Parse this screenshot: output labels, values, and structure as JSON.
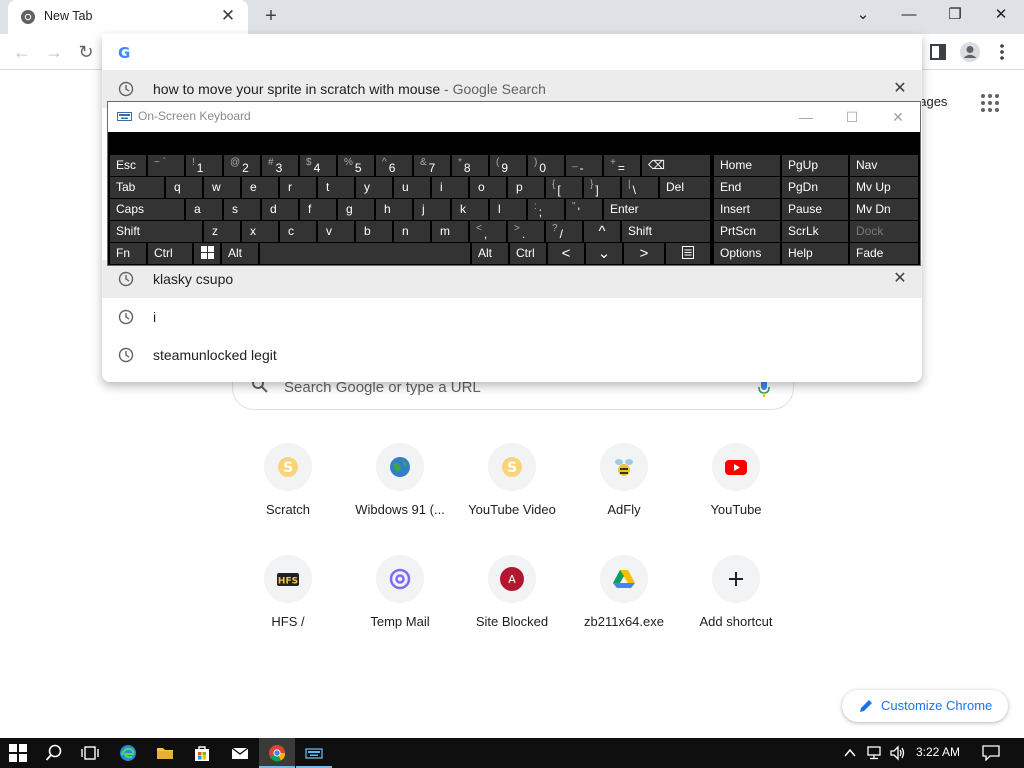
{
  "browser": {
    "tab_title": "New Tab",
    "tab_close": "✕",
    "new_tab": "+",
    "window_controls": [
      "⌄",
      "—",
      "❐",
      "✕"
    ]
  },
  "toolbar": {
    "back": "←",
    "forward": "→",
    "reload": "↻"
  },
  "omnibox": {
    "logo": "G",
    "input_value": "",
    "suggestions": [
      {
        "text": "how to move your sprite in scratch with mouse",
        "suffix": " - Google Search",
        "removable": true
      },
      {
        "text": "klasky csupo",
        "suffix": "",
        "removable": true
      },
      {
        "text": "i",
        "suffix": "",
        "removable": false
      },
      {
        "text": "steamunlocked legit",
        "suffix": "",
        "removable": false
      }
    ],
    "remove_glyph": "✕"
  },
  "ntp": {
    "images_link": "nages",
    "search_placeholder": "Search Google or type a URL",
    "shortcuts": [
      {
        "label": "Scratch",
        "icon": "scratch-icon"
      },
      {
        "label": "Wibdows 91 (...",
        "icon": "globe-icon"
      },
      {
        "label": "YouTube Video",
        "icon": "scratch-icon"
      },
      {
        "label": "AdFly",
        "icon": "adfly-icon"
      },
      {
        "label": "YouTube",
        "icon": "youtube-icon"
      },
      {
        "label": "HFS /",
        "icon": "hfs-icon"
      },
      {
        "label": "Temp Mail",
        "icon": "at-icon"
      },
      {
        "label": "Site Blocked",
        "icon": "letter-a-icon",
        "letter": "A"
      },
      {
        "label": "zb211x64.exe",
        "icon": "drive-icon"
      },
      {
        "label": "Add shortcut",
        "icon": "plus-icon"
      }
    ],
    "customize_label": "Customize Chrome"
  },
  "osk": {
    "title": "On-Screen Keyboard",
    "controls": [
      "—",
      "☐",
      "✕"
    ],
    "row1": {
      "esc": "Esc",
      "keys": [
        {
          "s": "~ `",
          "m": ""
        },
        {
          "s": "!",
          "m": "1"
        },
        {
          "s": "@",
          "m": "2"
        },
        {
          "s": "#",
          "m": "3"
        },
        {
          "s": "$",
          "m": "4"
        },
        {
          "s": "%",
          "m": "5"
        },
        {
          "s": "^",
          "m": "6"
        },
        {
          "s": "&",
          "m": "7"
        },
        {
          "s": "*",
          "m": "8"
        },
        {
          "s": "(",
          "m": "9"
        },
        {
          "s": ")",
          "m": "0"
        },
        {
          "s": "_",
          "m": "-"
        },
        {
          "s": "+",
          "m": "="
        }
      ],
      "backspace": "⌫"
    },
    "row2": {
      "tab": "Tab",
      "letters": [
        "q",
        "w",
        "e",
        "r",
        "t",
        "y",
        "u",
        "i",
        "o",
        "p"
      ],
      "brackets": [
        {
          "s": "{",
          "m": "["
        },
        {
          "s": "}",
          "m": "]"
        },
        {
          "s": "|",
          "m": "\\"
        }
      ],
      "del": "Del"
    },
    "row3": {
      "caps": "Caps",
      "letters": [
        "a",
        "s",
        "d",
        "f",
        "g",
        "h",
        "j",
        "k",
        "l"
      ],
      "punct": [
        {
          "s": ":",
          "m": ";"
        },
        {
          "s": "\"",
          "m": "'"
        }
      ],
      "enter": "Enter"
    },
    "row4": {
      "shift": "Shift",
      "letters": [
        "z",
        "x",
        "c",
        "v",
        "b",
        "n",
        "m"
      ],
      "punct": [
        {
          "s": "<",
          "m": ","
        },
        {
          "s": ">",
          "m": "."
        },
        {
          "s": "?",
          "m": "/"
        }
      ],
      "up": "^",
      "shift_right": "Shift"
    },
    "row5": {
      "fn": "Fn",
      "ctrl": "Ctrl",
      "alt": "Alt",
      "alt_right": "Alt",
      "ctrl_right": "Ctrl",
      "left": "<",
      "down": "⌄",
      "right": ">"
    },
    "nav_keys": [
      [
        "Home",
        "PgUp",
        "Nav"
      ],
      [
        "End",
        "PgDn",
        "Mv Up"
      ],
      [
        "Insert",
        "Pause",
        "Mv Dn"
      ],
      [
        "PrtScn",
        "ScrLk",
        "Dock"
      ],
      [
        "Options",
        "Help",
        "Fade"
      ]
    ]
  },
  "taskbar": {
    "time": "3:22 AM"
  }
}
